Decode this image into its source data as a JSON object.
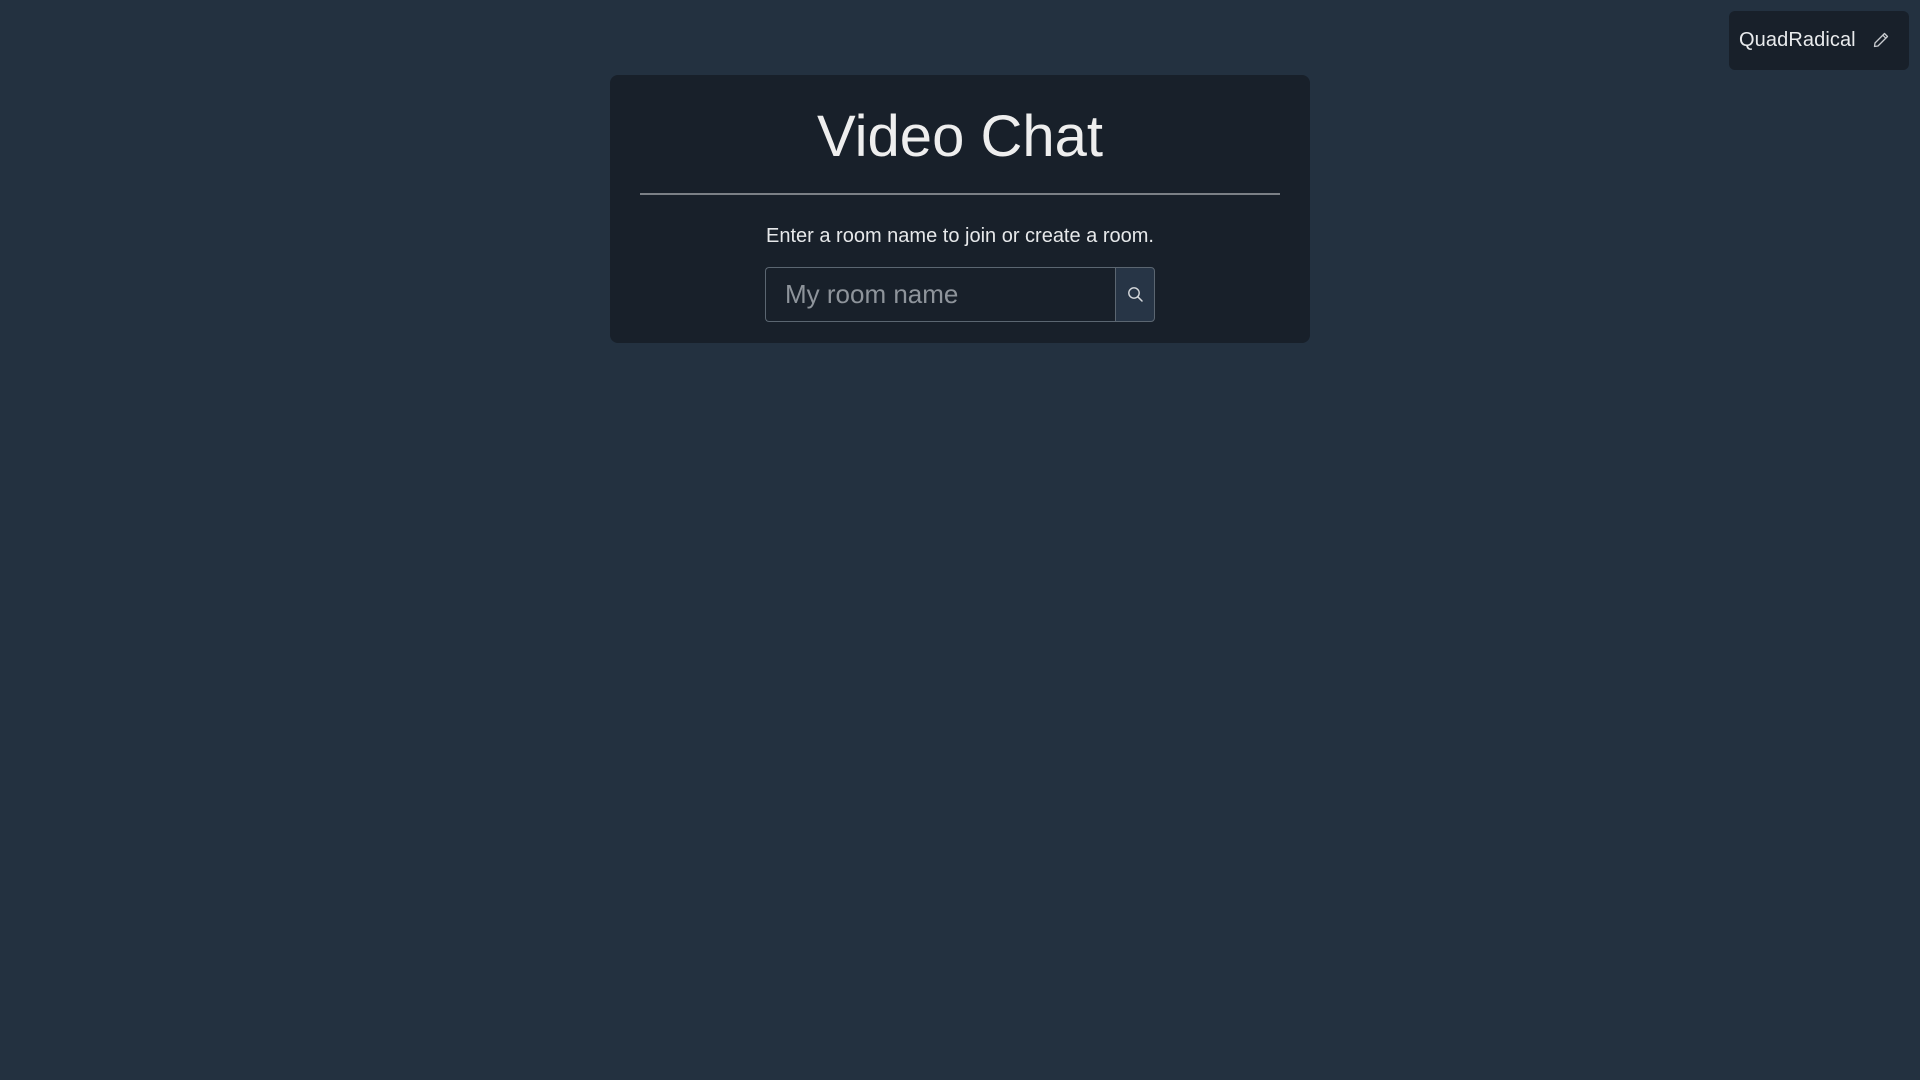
{
  "user": {
    "name": "QuadRadical",
    "edit_icon": "pencil-icon"
  },
  "card": {
    "title": "Video Chat",
    "subtitle": "Enter a room name to join or create a room.",
    "input": {
      "value": "",
      "placeholder": "My room name"
    },
    "search_icon": "search-icon"
  },
  "colors": {
    "background": "#233140",
    "card": "#18202a",
    "text": "#e6e8ea",
    "divider": "#7b8086",
    "button": "#273546"
  }
}
